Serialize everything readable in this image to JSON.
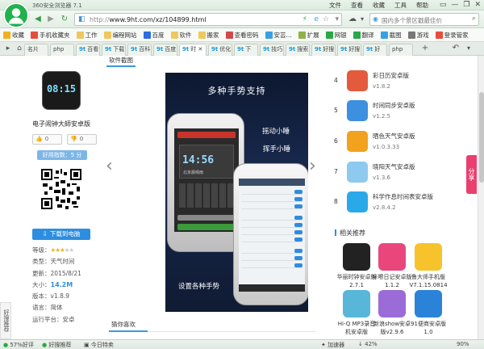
{
  "window": {
    "title": "360安全浏览器 7.1",
    "menu": [
      "文件",
      "查看",
      "收藏",
      "工具",
      "帮助"
    ],
    "controls": [
      "▭",
      "—",
      "❐",
      "✕"
    ]
  },
  "nav": {
    "url_grey": "http://",
    "url": "www.9ht.com/xz/104899.html",
    "search_placeholder": "国内多个景区戳最佳价"
  },
  "bookmarks": [
    {
      "label": "收藏",
      "color": "#f3b01e"
    },
    {
      "label": "手机收藏夹",
      "color": "#e84c3d"
    },
    {
      "label": "工作",
      "color": "#f0c75e"
    },
    {
      "label": "编程网站",
      "color": "#f0c75e"
    },
    {
      "label": "百度",
      "color": "#2d6ee1"
    },
    {
      "label": "软件",
      "color": "#f0c75e"
    },
    {
      "label": "搬家",
      "color": "#f0c75e"
    },
    {
      "label": "查看密码",
      "color": "#d04a4a"
    },
    {
      "label": "安芸...",
      "color": "#3aa0e6"
    },
    {
      "label": "扩展",
      "color": "#8fb04a"
    },
    {
      "label": "网银",
      "color": "#2aa845"
    },
    {
      "label": "翻译",
      "color": "#2aa845"
    },
    {
      "label": "截图",
      "color": "#3aa0e6"
    },
    {
      "label": "游戏",
      "color": "#777777"
    },
    {
      "label": "登录管家",
      "color": "#e84c3d"
    }
  ],
  "tabs": [
    {
      "label": "名片"
    },
    {
      "label": "php"
    },
    {
      "label": "百看"
    },
    {
      "label": "下载"
    },
    {
      "label": "百科"
    },
    {
      "label": "百度"
    },
    {
      "label": "时"
    },
    {
      "label": "优化"
    },
    {
      "label": "下"
    },
    {
      "label": "技巧"
    },
    {
      "label": "搜索"
    },
    {
      "label": "好搜"
    },
    {
      "label": "好搜"
    },
    {
      "label": "好"
    },
    {
      "label": "php"
    }
  ],
  "app": {
    "name": "电子闹钟大師安卓版",
    "clock_digits": "08:15",
    "likes_up": "0",
    "likes_down": "0",
    "rating_text": "好用指数：5 分",
    "download_label": "下载到电脑",
    "info": {
      "grade_label": "等级：",
      "stars_on": 3,
      "stars_total": 5,
      "type_label": "类型：",
      "type": "天气时间",
      "updated_label": "更新：",
      "updated": "2015/8/21",
      "size_label": "大小：",
      "size": "14.2M",
      "version_label": "版本：",
      "version": "v1.8.9",
      "lang_label": "语言：",
      "lang": "简体",
      "platform_label": "运行平台：",
      "platform": "安卓"
    }
  },
  "gallery": {
    "tab_label": "软件截图",
    "title": "多种手势支持",
    "caption1": "摇动小睡",
    "caption2": "挥手小睡",
    "caption3": "设置各种手势",
    "phone1_time": "14:56",
    "phone1_city": "北京晨晴雨"
  },
  "guess_label": "猜你喜欢",
  "ranks": [
    {
      "num": "4",
      "name": "彩日历安卓版",
      "ver": "v1.8.2",
      "color": "#e35b3c"
    },
    {
      "num": "5",
      "name": "时间同步安卓版",
      "ver": "v1.2.5",
      "color": "#3d8fe0"
    },
    {
      "num": "6",
      "name": "晒色天气安卓版",
      "ver": "v1.0.3.33",
      "color": "#f2a21c"
    },
    {
      "num": "7",
      "name": "晓阳天气安卓版",
      "ver": "v1.3.6",
      "color": "#8ec9f0"
    },
    {
      "num": "8",
      "name": "科学作息时间表安卓版",
      "ver": "v2.8.4.2",
      "color": "#2aa9e9"
    }
  ],
  "related": {
    "title": "相关推荐",
    "items": [
      {
        "name": "华丽时钟安卓版2.7.1",
        "color": "#222222"
      },
      {
        "name": "咔嚓日记安卓版1.1.2",
        "color": "#e9477c"
      },
      {
        "name": "鲁大师手机版V7.1.15.0814",
        "color": "#f6c32c"
      },
      {
        "name": "Hi-Q MP3录音机安卓版",
        "color": "#58b6d8"
      },
      {
        "name": "新浪show安卓版v2.9.6",
        "color": "#9b6cd8"
      },
      {
        "name": "91便商安卓版1.0",
        "color": "#2a83d8"
      }
    ]
  },
  "side": {
    "share": "分享",
    "left_tab": "好搜推荐"
  },
  "status": {
    "left1": "57%好评",
    "left2": "好搜推荐",
    "left3": "今日特卖",
    "accel": "加速器",
    "dl": "↓",
    "pct": "42%",
    "zoom": "90%"
  },
  "colors": {
    "brand_green": "#21b14e",
    "link_blue": "#2d8ee1",
    "share_pink": "#ea3f6f"
  }
}
